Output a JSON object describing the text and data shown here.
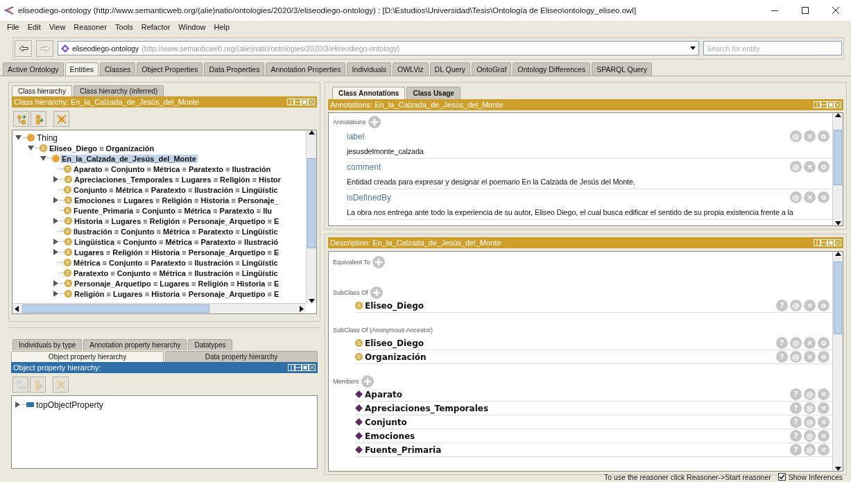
{
  "window": {
    "title": "eliseodiego-ontology (http://www.semanticweb.org/(alie)natio/ontologies/2020/3/eliseodiego-ontology) : [D:\\Estudios\\Universidad\\Tesis\\Ontología de Eliseo\\ontology_eliseo.owl]",
    "controls": [
      {
        "kind": "minimize"
      },
      {
        "kind": "maximize"
      },
      {
        "kind": "close"
      }
    ]
  },
  "menu": [
    "File",
    "Edit",
    "View",
    "Reasoner",
    "Tools",
    "Refactor",
    "Window",
    "Help"
  ],
  "navigation": [
    {
      "kind": "back",
      "disabled": false
    },
    {
      "kind": "forward",
      "disabled": true
    }
  ],
  "ontology_selector": {
    "name": "eliseodiego-ontology",
    "iri": "(http://www.semanticweb.org/(alie)natio/ontologies/2020/3/eliseodiego-ontology)"
  },
  "search": {
    "placeholder": "Search for entity"
  },
  "tabs": [
    {
      "label": "Active Ontology",
      "selected": false
    },
    {
      "label": "Entities",
      "selected": true
    },
    {
      "label": "Classes",
      "selected": false
    },
    {
      "label": "Object Properties",
      "selected": false
    },
    {
      "label": "Data Properties",
      "selected": false
    },
    {
      "label": "Annotation Properties",
      "selected": false
    },
    {
      "label": "Individuals",
      "selected": false
    },
    {
      "label": "OWLViz",
      "selected": false
    },
    {
      "label": "DL Query",
      "selected": false
    },
    {
      "label": "OntoGraf",
      "selected": false
    },
    {
      "label": "Ontology Differences",
      "selected": false
    },
    {
      "label": "SPARQL Query",
      "selected": false
    }
  ],
  "class_hierarchy": {
    "tabs": [
      {
        "label": "Class hierarchy",
        "selected": true
      },
      {
        "label": "Class hierarchy (inferred)",
        "selected": false
      }
    ],
    "header": "Class hierarchy: En_la_Calzada_de_Jesús_del_Monte",
    "focused": false,
    "toolbar": [
      {
        "kind": "add_subclass",
        "disabled": false
      },
      {
        "kind": "add_sibling",
        "disabled": false
      },
      {
        "kind": "delete",
        "disabled": false
      }
    ],
    "tree": [
      {
        "label": "Thing",
        "kind": "thing",
        "expanded": true,
        "selected": false,
        "children": [
          {
            "label": "Eliseo_Diego ≡ Organización",
            "kind": "defined",
            "expanded": true,
            "selected": false,
            "children": [
              {
                "label": "En_la_Calzada_de_Jesús_del_Monte",
                "kind": "primitive",
                "expanded": true,
                "selected": true,
                "children": [
                  {
                    "label": "Aparato ≡ Conjunto ≡ Métrica ≡ Paratexto ≡ Ilustración",
                    "kind": "defined",
                    "selected": false
                  },
                  {
                    "label": "Apreciaciones_Temporales ≡ Lugares ≡ Religión ≡ Histor",
                    "kind": "defined",
                    "expanded": false,
                    "selected": false
                  },
                  {
                    "label": "Conjunto ≡ Métrica ≡ Paratexto ≡ Ilustración ≡ Lingüístic",
                    "kind": "defined",
                    "selected": false
                  },
                  {
                    "label": "Emociones ≡ Lugares ≡ Religión ≡ Historia ≡ Personaje_",
                    "kind": "defined",
                    "expanded": false,
                    "selected": false
                  },
                  {
                    "label": "Fuente_Primaria ≡ Conjunto ≡ Métrica ≡ Paratexto ≡ Ilu",
                    "kind": "defined",
                    "selected": false
                  },
                  {
                    "label": "Historia ≡ Lugares ≡ Religión ≡ Personaje_Arquetipo ≡ E",
                    "kind": "defined",
                    "expanded": false,
                    "selected": false
                  },
                  {
                    "label": "Ilustración ≡ Conjunto ≡ Métrica ≡ Paratexto ≡ Lingüístic",
                    "kind": "defined",
                    "selected": false
                  },
                  {
                    "label": "Lingüística ≡ Conjunto ≡ Métrica ≡ Paratexto ≡ Ilustració",
                    "kind": "defined",
                    "expanded": false,
                    "selected": false
                  },
                  {
                    "label": "Lugares ≡ Religión ≡ Historia ≡ Personaje_Arquetipo ≡ E",
                    "kind": "defined",
                    "expanded": false,
                    "selected": false
                  },
                  {
                    "label": "Métrica ≡ Conjunto ≡ Paratexto ≡ Ilustración ≡ Lingüístic",
                    "kind": "defined",
                    "selected": false
                  },
                  {
                    "label": "Paratexto ≡ Conjunto ≡ Métrica ≡ Ilustración ≡ Lingüístic",
                    "kind": "defined",
                    "selected": false
                  },
                  {
                    "label": "Personaje_Arquetipo ≡ Lugares ≡ Religión ≡ Historia ≡ E",
                    "kind": "defined",
                    "expanded": false,
                    "selected": false
                  },
                  {
                    "label": "Religión ≡ Lugares ≡ Historia ≡ Personaje_Arquetipo ≡ E",
                    "kind": "defined",
                    "expanded": false,
                    "selected": false
                  }
                ]
              }
            ]
          }
        ]
      }
    ]
  },
  "property_hierarchy": {
    "tabs_back": [
      {
        "label": "Individuals by type",
        "selected": false
      },
      {
        "label": "Annotation property hierarchy",
        "selected": false
      },
      {
        "label": "Datatypes",
        "selected": false
      }
    ],
    "tabs_front": [
      {
        "label": "Object property hierarchy",
        "selected": true
      },
      {
        "label": "Data property hierarchy",
        "selected": false
      }
    ],
    "header": "Object property hierarchy:",
    "focused": true,
    "toolbar": [
      {
        "kind": "add_subproperty",
        "disabled": true
      },
      {
        "kind": "add_sibling",
        "disabled": true
      },
      {
        "kind": "delete",
        "disabled": true
      }
    ],
    "tree": [
      {
        "label": "topObjectProperty",
        "expanded": false,
        "selected": false
      }
    ]
  },
  "annotation_tabs": [
    {
      "label": "Class Annotations",
      "selected": true
    },
    {
      "label": "Class Usage",
      "selected": false
    }
  ],
  "annotations": {
    "header": "Annotations: En_la_Calzada_de_Jesús_del_Monte",
    "focused": false,
    "section": "Annotations",
    "items": [
      {
        "property": "label",
        "value": "jesusdelmonte_calzada",
        "buttons": [
          "@",
          "×",
          "o"
        ]
      },
      {
        "property": "comment",
        "value": "Entidad creada para expresar y designar el poemario En la Calzada de Jesús del Monte.",
        "buttons": [
          "@",
          "×",
          "o"
        ]
      },
      {
        "property": "isDefinedBy",
        "value": "La obra nos entrega ante todo la experiencia de su autor, Eliseo Diego, el cual busca edificar el sentido de su propia existencia frente a la",
        "buttons": [
          "@",
          "×",
          "o"
        ]
      }
    ]
  },
  "description": {
    "header": "Description: En_la_Calzada_de_Jesús_del_Monte",
    "focused": false,
    "sections": [
      {
        "title": "Equivalent To",
        "addable": true
      },
      {
        "title": "SubClass Of",
        "addable": true,
        "items": [
          {
            "label": "Eliseo_Diego",
            "kind": "class",
            "buttons": [
              "?",
              "@",
              "×",
              "o"
            ]
          }
        ]
      },
      {
        "title": "SubClass Of (Anonymous Ancestor)",
        "addable": false,
        "items": [
          {
            "label": "Eliseo_Diego",
            "kind": "class",
            "buttons": [
              "?",
              "@",
              "×",
              "o"
            ]
          },
          {
            "label": "Organización",
            "kind": "class",
            "buttons": [
              "?",
              "@",
              "×",
              "o"
            ]
          }
        ]
      },
      {
        "title": "Members",
        "addable": true,
        "items": [
          {
            "label": "Aparato",
            "kind": "individual",
            "buttons": [
              "?",
              "@",
              "×"
            ]
          },
          {
            "label": "Apreciaciones_Temporales",
            "kind": "individual",
            "buttons": [
              "?",
              "@",
              "×"
            ]
          },
          {
            "label": "Conjunto",
            "kind": "individual",
            "buttons": [
              "?",
              "@",
              "×"
            ]
          },
          {
            "label": "Emociones",
            "kind": "individual",
            "buttons": [
              "?",
              "@",
              "×"
            ]
          },
          {
            "label": "Fuente_Primaria",
            "kind": "individual",
            "buttons": [
              "?",
              "@",
              "×"
            ]
          }
        ]
      }
    ]
  },
  "status": {
    "message": "To use the reasoner click Reasoner->Start reasoner",
    "show_inferences": {
      "label": "Show Inferences",
      "checked": true
    }
  }
}
